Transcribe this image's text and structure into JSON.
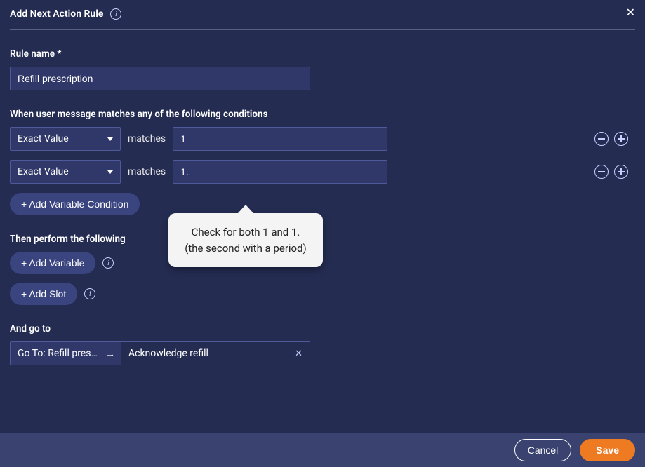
{
  "dialog": {
    "title": "Add Next Action Rule"
  },
  "ruleName": {
    "label": "Rule name *",
    "value": "Refill prescription"
  },
  "conditions": {
    "heading": "When user message matches any of the following conditions",
    "rows": [
      {
        "operator": "Exact Value",
        "keyword": "matches",
        "value": "1"
      },
      {
        "operator": "Exact Value",
        "keyword": "matches",
        "value": "1."
      }
    ],
    "addVariableCondition": "+ Add Variable Condition"
  },
  "actions": {
    "heading": "Then perform the following",
    "addVariable": "+ Add Variable",
    "addSlot": "+ Add Slot"
  },
  "goto": {
    "heading": "And go to",
    "selectLabel": "Go To: Refill prescri…",
    "target": "Acknowledge refill"
  },
  "footer": {
    "cancel": "Cancel",
    "save": "Save"
  },
  "tooltip": {
    "line1": "Check for both 1 and 1.",
    "line2": "(the second with a period)"
  }
}
